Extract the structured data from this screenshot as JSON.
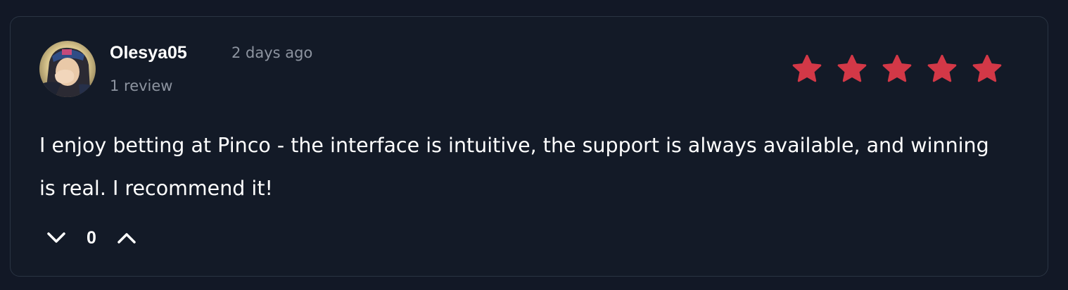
{
  "review": {
    "author": "Olesya05",
    "date": "2 days ago",
    "review_count": "1 review",
    "rating": 5,
    "text": "I enjoy betting at Pinco - the interface is intuitive, the support is always available, and winning is real. I recommend it!",
    "votes": {
      "count": "0",
      "downvote_icon": "chevron-down-icon",
      "upvote_icon": "chevron-up-icon"
    }
  },
  "colors": {
    "background": "#121826",
    "card_border": "#2a3443",
    "star": "#d33847",
    "text": "#ffffff",
    "muted": "#8d94a0"
  }
}
